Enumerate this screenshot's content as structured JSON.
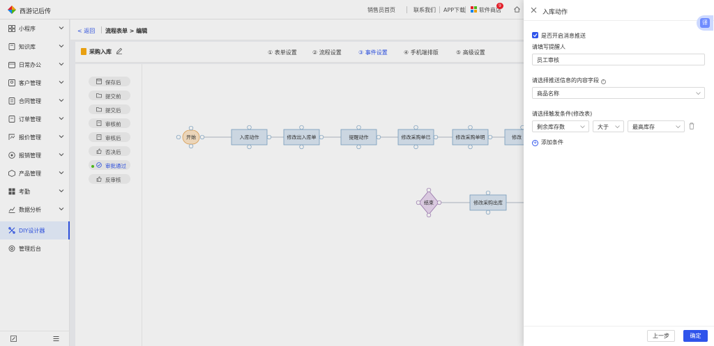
{
  "app": {
    "title": "西游记后传"
  },
  "topnav": {
    "items": [
      "销售员首页",
      "联系我们",
      "APP下载",
      "软件商店"
    ],
    "badge": "9"
  },
  "sidebar": {
    "items": [
      {
        "label": "小程序",
        "icon": "grid-icon",
        "chevron": true
      },
      {
        "label": "知识库",
        "icon": "book-icon",
        "chevron": true
      },
      {
        "label": "日常办公",
        "icon": "calendar-icon",
        "chevron": true
      },
      {
        "label": "客户管理",
        "icon": "customer-icon",
        "chevron": true
      },
      {
        "label": "合同管理",
        "icon": "contract-icon",
        "chevron": true
      },
      {
        "label": "订单管理",
        "icon": "order-icon",
        "chevron": true
      },
      {
        "label": "报价管理",
        "icon": "quote-icon",
        "chevron": true
      },
      {
        "label": "报销管理",
        "icon": "expense-icon",
        "chevron": true
      },
      {
        "label": "产品管理",
        "icon": "product-icon",
        "chevron": true
      },
      {
        "label": "考勤",
        "icon": "attendance-icon",
        "chevron": true
      },
      {
        "label": "数据分析",
        "icon": "chart-icon",
        "chevron": true
      },
      {
        "label": "DIY设计器",
        "icon": "diy-icon",
        "chevron": false,
        "active": true
      },
      {
        "label": "管理后台",
        "icon": "settings-icon",
        "chevron": false
      }
    ]
  },
  "breadcrumb": {
    "back": "< 返回",
    "path": "流程表单 > 编辑"
  },
  "form": {
    "name": "采购入库"
  },
  "steps": [
    "① 表单设置",
    "② 流程设置",
    "③ 事件设置",
    "④ 手机端排版",
    "⑤ 高级设置"
  ],
  "active_step": 2,
  "events": [
    {
      "label": "保存后",
      "icon": "save-icon"
    },
    {
      "label": "提交前",
      "icon": "folder-icon"
    },
    {
      "label": "提交后",
      "icon": "folder-icon"
    },
    {
      "label": "审核前",
      "icon": "doc-icon"
    },
    {
      "label": "审核后",
      "icon": "doc-icon"
    },
    {
      "label": "否决后",
      "icon": "thumb-icon"
    },
    {
      "label": "审批通过",
      "icon": "check-circle-icon",
      "active": true
    },
    {
      "label": "反审核",
      "icon": "thumb-icon"
    }
  ],
  "flow_nodes": {
    "start": "开始",
    "n1": "入库动作",
    "n2": "修改出入库单",
    "n3": "提醒动作",
    "n4": "修改采购单已",
    "n5": "修改采购单明",
    "n6": "修改",
    "end": "结束",
    "n7": "修改采购出库"
  },
  "drawer": {
    "title": "入库动作",
    "translate": "译",
    "checkbox_label": "是否开启消息推送",
    "remind_label": "请填写提醒人",
    "remind_value": "员工审核",
    "content_label": "请选择推送信息的内容字段",
    "content_value": "商品名称",
    "trigger_label": "请选择触发条件(修改表)",
    "cond_field": "剩余库存数",
    "cond_op": "大于",
    "cond_value": "最高库存",
    "add_condition": "添加条件",
    "prev": "上一步",
    "ok": "确定"
  },
  "colors": {
    "primary": "#2f54eb",
    "node_fill": "#dbe7f3",
    "node_stroke": "#7fa7c9"
  }
}
